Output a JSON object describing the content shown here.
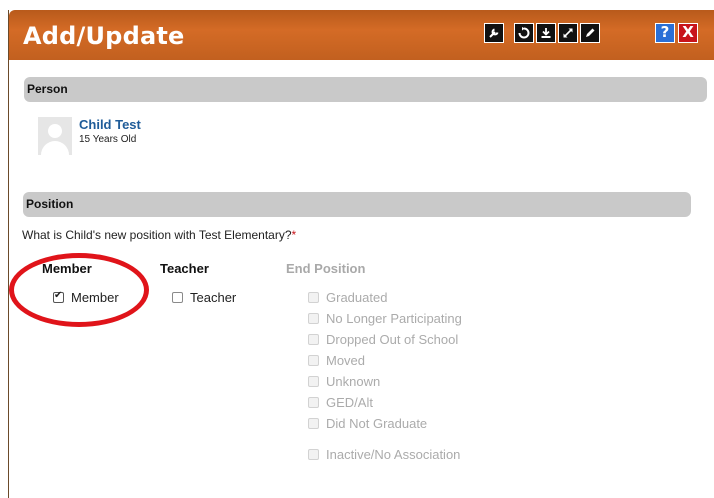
{
  "dialog": {
    "title": "Add/Update",
    "toolbar": {
      "help_label": "?",
      "close_label": "X"
    }
  },
  "person_section": {
    "header": "Person",
    "name": "Child Test",
    "age": "15 Years Old"
  },
  "position_section": {
    "header": "Position",
    "question": "What is Child's new position with Test Elementary?",
    "required_marker": "*",
    "columns": {
      "member": {
        "header": "Member",
        "option": {
          "label": "Member",
          "checked": true
        }
      },
      "teacher": {
        "header": "Teacher",
        "option": {
          "label": "Teacher",
          "checked": false
        }
      },
      "end_position": {
        "header": "End Position",
        "options": [
          {
            "label": "Graduated",
            "checked": false,
            "disabled": true
          },
          {
            "label": "No Longer Participating",
            "checked": false,
            "disabled": true
          },
          {
            "label": "Dropped Out of School",
            "checked": false,
            "disabled": true
          },
          {
            "label": "Moved",
            "checked": false,
            "disabled": true
          },
          {
            "label": "Unknown",
            "checked": false,
            "disabled": true
          },
          {
            "label": "GED/Alt",
            "checked": false,
            "disabled": true
          },
          {
            "label": "Did Not Graduate",
            "checked": false,
            "disabled": true
          },
          {
            "label": "Inactive/No Association",
            "checked": false,
            "disabled": true
          }
        ]
      }
    }
  },
  "colors": {
    "titlebar": "#c2601f",
    "link": "#1f5c99",
    "annotation_circle": "#e0141a",
    "required": "#c8141b"
  }
}
